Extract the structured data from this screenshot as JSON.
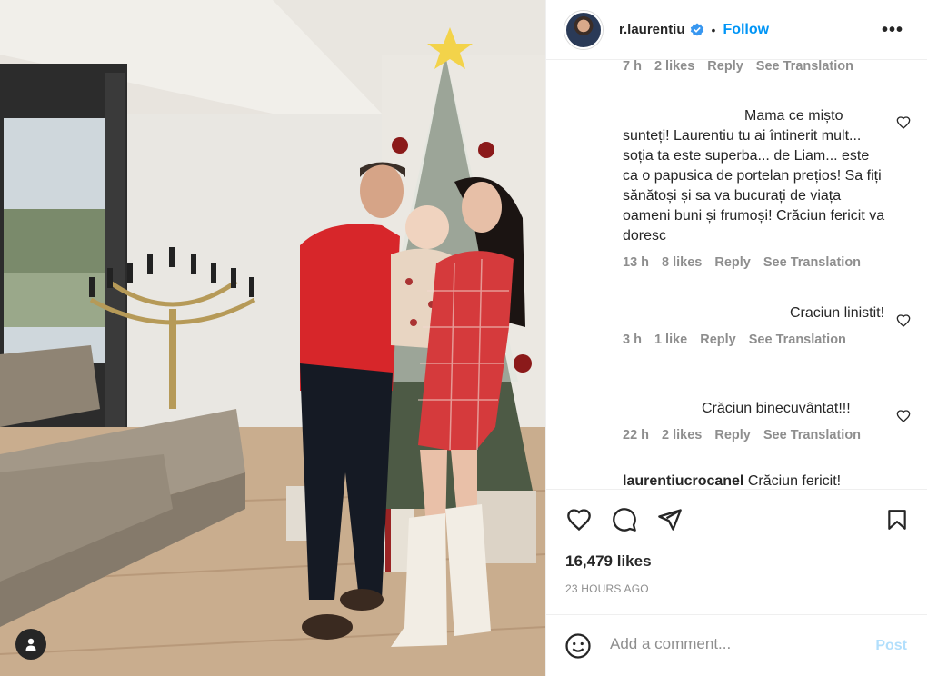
{
  "header": {
    "username": "r.laurentiu",
    "separator": "•",
    "follow_label": "Follow",
    "more_icon": "more-icon",
    "more_label": "•••"
  },
  "comments": [
    {
      "text": "",
      "time": "7 h",
      "likes": "2 likes",
      "reply": "Reply",
      "translate": "See Translation"
    },
    {
      "text": "Mama ce mișto sunteți! Laurentiu tu ai întinerit mult... soția ta este superba... de Liam... este ca o papusica de portelan prețios! Sa fiți sănătoși și sa va bucurați de viața oameni buni și frumoși! Crăciun fericit va doresc",
      "time": "13 h",
      "likes": "8 likes",
      "reply": "Reply",
      "translate": "See Translation"
    },
    {
      "text": "Craciun linistit!",
      "time": "3 h",
      "likes": "1 like",
      "reply": "Reply",
      "translate": "See Translation"
    },
    {
      "text": "Crăciun binecuvântat!!!",
      "time": "22 h",
      "likes": "2 likes",
      "reply": "Reply",
      "translate": "See Translation"
    },
    {
      "username": "laurentiucrocanel",
      "text": "Crăciun fericit!"
    }
  ],
  "engagement": {
    "likes": "16,479 likes",
    "time": "23 HOURS AGO"
  },
  "add_comment": {
    "placeholder": "Add a comment...",
    "post_label": "Post",
    "post_color": "#b2dffc"
  },
  "colors": {
    "follow": "#0095f6",
    "verified": "#3897f0",
    "muted": "#8e8e8e"
  }
}
